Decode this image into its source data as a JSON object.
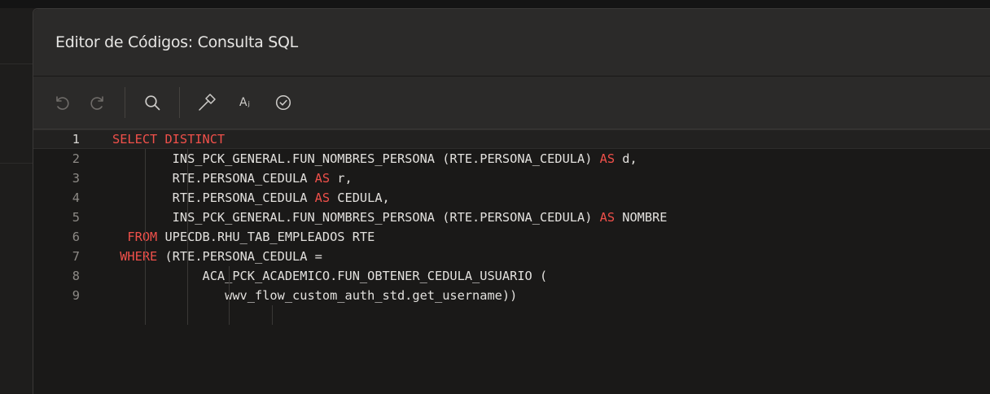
{
  "dialog": {
    "title": "Editor de Códigos: Consulta SQL"
  },
  "toolbar": {
    "buttons": [
      {
        "name": "undo",
        "icon": "undo-icon"
      },
      {
        "name": "redo",
        "icon": "redo-icon"
      },
      {
        "name": "search",
        "icon": "search-icon"
      },
      {
        "name": "validate",
        "icon": "hammer-icon"
      },
      {
        "name": "format",
        "icon": "format-text-icon",
        "label": "A≡"
      },
      {
        "name": "check",
        "icon": "check-circle-icon"
      }
    ],
    "format_label": "Aⱼ"
  },
  "editor": {
    "lines": [
      {
        "number": "1",
        "tokens": [
          {
            "t": "SELECT DISTINCT",
            "kw": true
          }
        ]
      },
      {
        "number": "2",
        "tokens": [
          {
            "t": "        INS_PCK_GENERAL.FUN_NOMBRES_PERSONA (RTE.PERSONA_CEDULA) "
          },
          {
            "t": "AS",
            "kw": true
          },
          {
            "t": " d,"
          }
        ]
      },
      {
        "number": "3",
        "tokens": [
          {
            "t": "        RTE.PERSONA_CEDULA "
          },
          {
            "t": "AS",
            "kw": true
          },
          {
            "t": " r,"
          }
        ]
      },
      {
        "number": "4",
        "tokens": [
          {
            "t": "        RTE.PERSONA_CEDULA "
          },
          {
            "t": "AS",
            "kw": true
          },
          {
            "t": " CEDULA,"
          }
        ]
      },
      {
        "number": "5",
        "tokens": [
          {
            "t": "        INS_PCK_GENERAL.FUN_NOMBRES_PERSONA (RTE.PERSONA_CEDULA) "
          },
          {
            "t": "AS",
            "kw": true
          },
          {
            "t": " NOMBRE"
          }
        ]
      },
      {
        "number": "6",
        "tokens": [
          {
            "t": "  "
          },
          {
            "t": "FROM",
            "kw": true
          },
          {
            "t": " UPECDB.RHU_TAB_EMPLEADOS RTE"
          }
        ]
      },
      {
        "number": "7",
        "tokens": [
          {
            "t": " "
          },
          {
            "t": "WHERE",
            "kw": true
          },
          {
            "t": " (RTE.PERSONA_CEDULA ="
          }
        ]
      },
      {
        "number": "8",
        "tokens": [
          {
            "t": "            ACA_PCK_ACADEMICO.FUN_OBTENER_CEDULA_USUARIO ("
          }
        ]
      },
      {
        "number": "9",
        "tokens": [
          {
            "t": "               wwv_flow_custom_auth_std.get_username))"
          }
        ]
      }
    ]
  },
  "colors": {
    "keyword": "#f0504a",
    "text": "#e2e0dd",
    "line_number": "#8d8a86",
    "background": "#1a1918",
    "toolbar": "#2b2a29"
  }
}
